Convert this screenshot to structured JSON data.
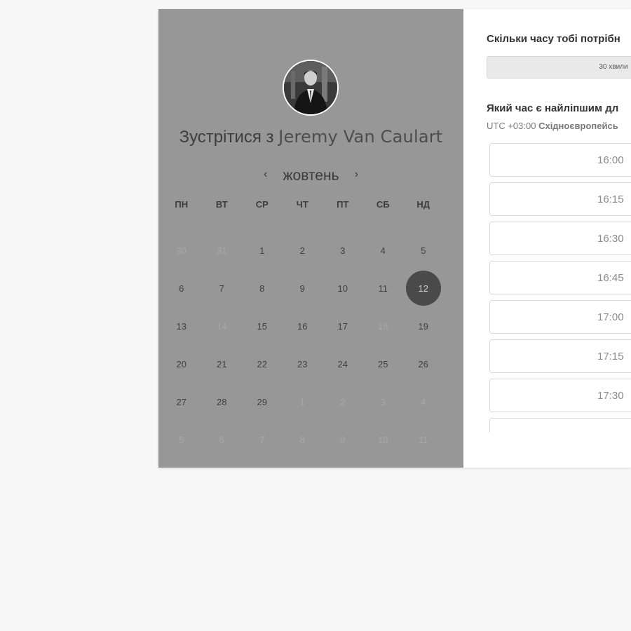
{
  "host": {
    "prefix": "Зустрітися з",
    "name": "Jeremy Van Caulart"
  },
  "calendar": {
    "month": "жовтень",
    "prev_icon": "chevron-left-icon",
    "next_icon": "chevron-right-icon",
    "weekdays": [
      "ПН",
      "ВТ",
      "СР",
      "ЧТ",
      "ПТ",
      "СБ",
      "НД"
    ],
    "weeks": [
      [
        {
          "d": "30",
          "m": true
        },
        {
          "d": "31",
          "m": true
        },
        {
          "d": "1"
        },
        {
          "d": "2"
        },
        {
          "d": "3"
        },
        {
          "d": "4"
        },
        {
          "d": "5"
        }
      ],
      [
        {
          "d": "6"
        },
        {
          "d": "7"
        },
        {
          "d": "8"
        },
        {
          "d": "9"
        },
        {
          "d": "10"
        },
        {
          "d": "11"
        },
        {
          "d": "12",
          "s": true
        }
      ],
      [
        {
          "d": "13"
        },
        {
          "d": "14",
          "m": true
        },
        {
          "d": "15"
        },
        {
          "d": "16"
        },
        {
          "d": "17"
        },
        {
          "d": "18",
          "m": true
        },
        {
          "d": "19"
        }
      ],
      [
        {
          "d": "20"
        },
        {
          "d": "21"
        },
        {
          "d": "22"
        },
        {
          "d": "23"
        },
        {
          "d": "24"
        },
        {
          "d": "25"
        },
        {
          "d": "26"
        }
      ],
      [
        {
          "d": "27"
        },
        {
          "d": "28"
        },
        {
          "d": "29"
        },
        {
          "d": "1",
          "m": true
        },
        {
          "d": "2",
          "m": true
        },
        {
          "d": "3",
          "m": true
        },
        {
          "d": "4",
          "m": true
        }
      ],
      [
        {
          "d": "5",
          "m": true
        },
        {
          "d": "6",
          "m": true
        },
        {
          "d": "7",
          "m": true
        },
        {
          "d": "8",
          "m": true
        },
        {
          "d": "9",
          "m": true
        },
        {
          "d": "10",
          "m": true
        },
        {
          "d": "11",
          "m": true
        }
      ]
    ],
    "selected_day": "12"
  },
  "booking": {
    "duration_question": "Скільки часу тобі потрібн",
    "duration_value": "30 хвили",
    "time_question": "Який час є найліпшим дл",
    "tz_offset": "UTC +03:00",
    "tz_name": "Східноєвропейсь",
    "slots": [
      "16:00",
      "16:15",
      "16:30",
      "16:45",
      "17:00",
      "17:15",
      "17:30",
      ""
    ]
  }
}
